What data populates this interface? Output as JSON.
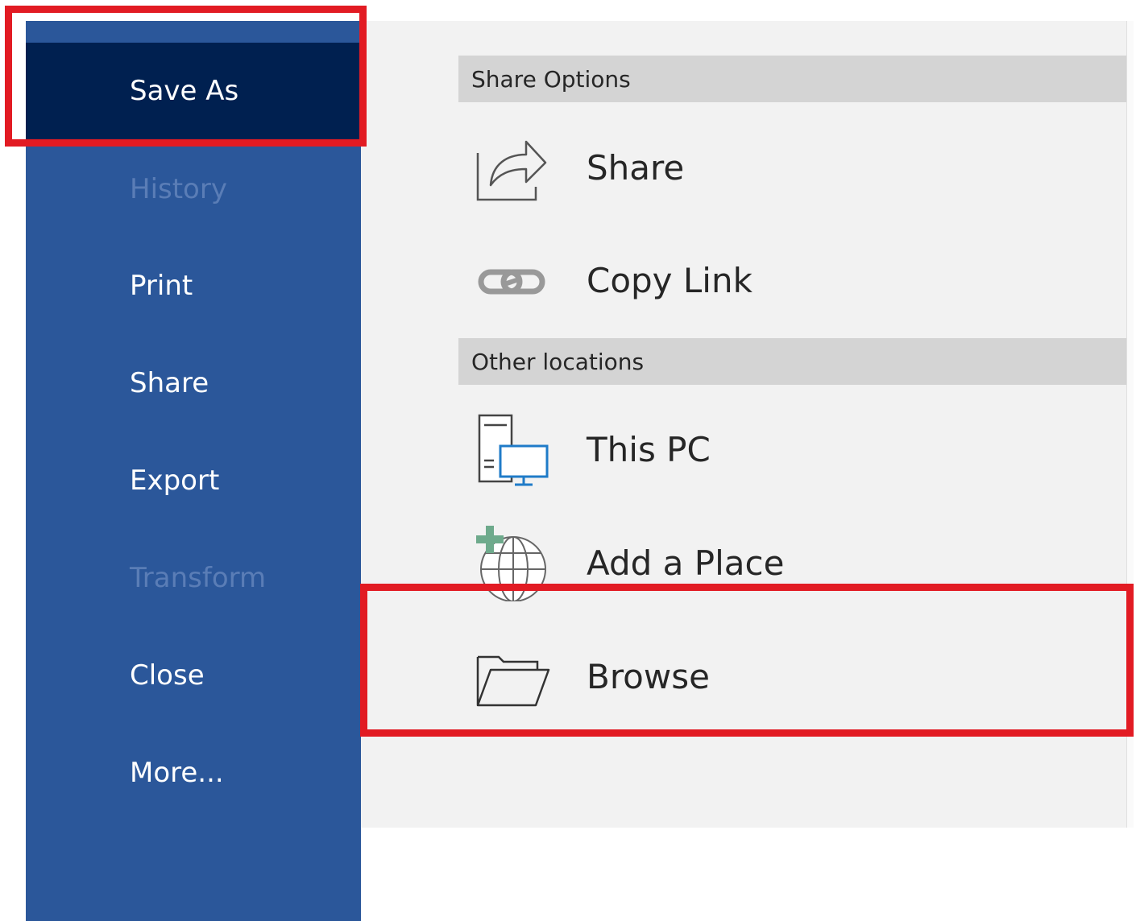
{
  "sidebar": {
    "items": [
      {
        "label": "Save As",
        "state": "selected"
      },
      {
        "label": "History",
        "state": "disabled"
      },
      {
        "label": "Print",
        "state": "normal"
      },
      {
        "label": "Share",
        "state": "normal"
      },
      {
        "label": "Export",
        "state": "normal"
      },
      {
        "label": "Transform",
        "state": "disabled"
      },
      {
        "label": "Close",
        "state": "normal"
      },
      {
        "label": "More...",
        "state": "normal"
      }
    ]
  },
  "main": {
    "share_options": {
      "header": "Share Options",
      "items": [
        {
          "label": "Share",
          "icon": "share-icon"
        },
        {
          "label": "Copy Link",
          "icon": "link-icon"
        }
      ]
    },
    "other_locations": {
      "header": "Other locations",
      "items": [
        {
          "label": "This PC",
          "icon": "this-pc-icon"
        },
        {
          "label": "Add a Place",
          "icon": "add-place-globe-icon"
        },
        {
          "label": "Browse",
          "icon": "folder-icon"
        }
      ]
    }
  },
  "colors": {
    "sidebar": "#2b579a",
    "sidebar_selected": "#002050",
    "highlight": "#e21b23",
    "content_bg": "#f2f2f2",
    "section_header_bg": "#d4d4d4"
  }
}
